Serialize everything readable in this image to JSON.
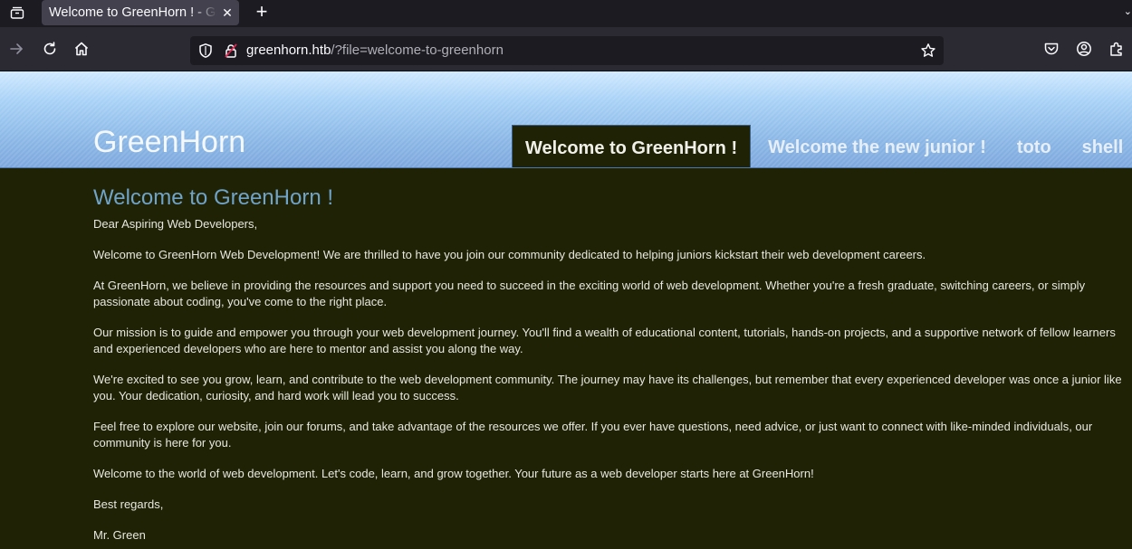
{
  "browser": {
    "tab_title": "Welcome to GreenHorn ! - GreenHorn",
    "tab_close": "✕",
    "new_tab": "+",
    "overflow": "⌄",
    "url_host": "greenhorn.htb",
    "url_path": "/?file=welcome-to-greenhorn"
  },
  "site": {
    "logo": "GreenHorn",
    "nav": [
      {
        "label": "Welcome to GreenHorn !",
        "active": true
      },
      {
        "label": "Welcome the new junior !",
        "active": false
      },
      {
        "label": "toto",
        "active": false
      },
      {
        "label": "shell",
        "active": false
      }
    ]
  },
  "article": {
    "title": "Welcome to GreenHorn !",
    "paragraphs": [
      "Dear Aspiring Web Developers,",
      "Welcome to GreenHorn Web Development! We are thrilled to have you join our community dedicated to helping juniors kickstart their web development careers.",
      "At GreenHorn, we believe in providing the resources and support you need to succeed in the exciting world of web development. Whether you're a fresh graduate, switching careers, or simply passionate about coding, you've come to the right place.",
      "Our mission is to guide and empower you through your web development journey. You'll find a wealth of educational content, tutorials, hands-on projects, and a supportive network of fellow learners and experienced developers who are here to mentor and assist you along the way.",
      "We're excited to see you grow, learn, and contribute to the web development community. The journey may have its challenges, but remember that every experienced developer was once a junior like you. Your dedication, curiosity, and hard work will lead you to success.",
      "Feel free to explore our website, join our forums, and take advantage of the resources we offer. If you ever have questions, need advice, or just want to connect with like-minded individuals, our community is here for you.",
      "Welcome to the world of web development. Let's code, learn, and grow together. Your future as a web developer starts here at GreenHorn!",
      "Best regards,",
      "Mr. Green"
    ]
  },
  "colors": {
    "page_bg": "#1f2205",
    "heading": "#6fa3c8",
    "header_sky": "#a8d2f6"
  }
}
